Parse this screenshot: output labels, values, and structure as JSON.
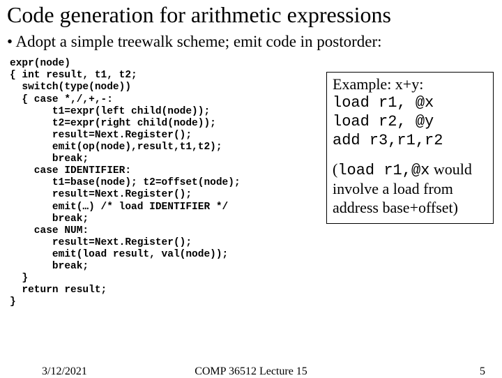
{
  "title": "Code generation for arithmetic expressions",
  "bullet": "Adopt a simple treewalk scheme; emit code in postorder:",
  "code": "expr(node)\n{ int result, t1, t2;\n  switch(type(node))\n  { case *,/,+,-:\n       t1=expr(left child(node));\n       t2=expr(right child(node));\n       result=Next.Register();\n       emit(op(node),result,t1,t2);\n       break;\n    case IDENTIFIER:\n       t1=base(node); t2=offset(node);\n       result=Next.Register();\n       emit(…) /* load IDENTIFIER */\n       break;\n    case NUM:\n       result=Next.Register();\n       emit(load result, val(node));\n       break;\n  }\n  return result;\n}",
  "example": {
    "heading": "Example: x+y:",
    "lines": [
      "load r1, @x",
      "load r2, @y",
      "add r3,r1,r2"
    ],
    "note_code": "load r1,@x",
    "note_rest": " would involve a load from address base+offset)"
  },
  "footer": {
    "date": "3/12/2021",
    "center": "COMP 36512 Lecture 15",
    "page": "5"
  }
}
